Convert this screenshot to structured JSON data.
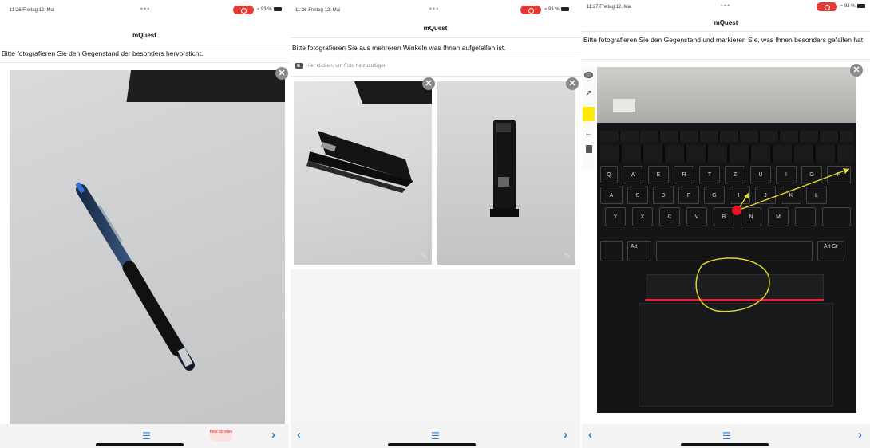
{
  "app": {
    "title": "mQuest"
  },
  "panels": [
    {
      "time": "11:26  Freitag 12. Mai",
      "dots": "•••",
      "battery": "93 %",
      "question": "Bitte fotografieren Sie den Gegenstand der besonders hervorsticht.",
      "scroll_hint": "Bitte scrollen"
    },
    {
      "time": "11:26  Freitag 12. Mai",
      "dots": "•••",
      "battery": "93 %",
      "question": "Bitte fotografieren Sie aus mehreren Winkeln was Ihnen aufgefallen ist.",
      "add_photo": "Hier klicken, um Foto hinzuzufügen"
    },
    {
      "time": "11:27  Freitag 12. Mai",
      "dots": "•••",
      "battery": "93 %",
      "question": "Bitte fotografieren Sie den Gegenstand und markieren Sie, was Ihnen besonders gefallen hat"
    }
  ],
  "icons": {
    "close": "close-icon",
    "menu": "hamburger-menu-icon",
    "next": "chevron-right-icon",
    "prev": "chevron-left-icon",
    "edit": "pencil-icon",
    "camera": "camera-icon",
    "tools": [
      "ellipse-tool-icon",
      "arrow-tool-icon",
      "color-picker-icon",
      "undo-icon",
      "trash-icon"
    ]
  },
  "keyboard": {
    "row1": [
      "Q",
      "W",
      "E",
      "R",
      "T",
      "Z",
      "U",
      "I",
      "O",
      "P"
    ],
    "row2": [
      "A",
      "S",
      "D",
      "F",
      "G",
      "H",
      "J",
      "K",
      "L"
    ],
    "row3": [
      "Y",
      "X",
      "C",
      "V",
      "B",
      "N",
      "M"
    ],
    "special": [
      "Alt",
      "Alt Gr"
    ]
  },
  "colors": {
    "accent": "#2a7de1",
    "record": "#e53935",
    "annotation": "#ffea00",
    "marker": "#e8142c"
  }
}
